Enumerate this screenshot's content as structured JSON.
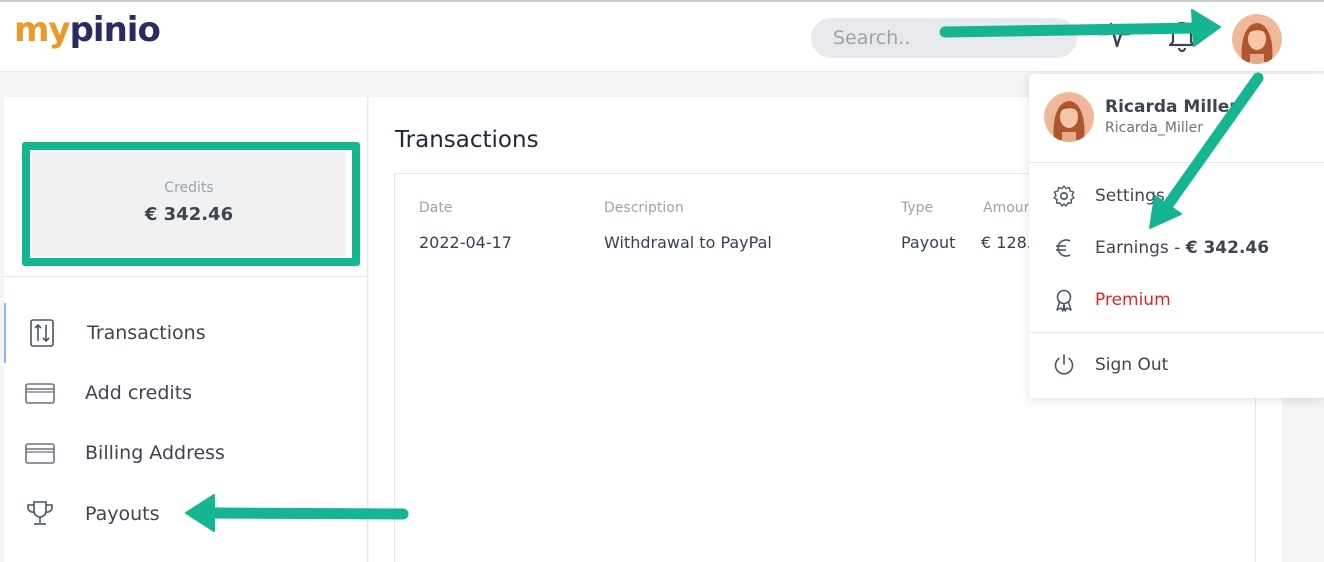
{
  "header": {
    "logo_part1": "my",
    "logo_part2": "pinio",
    "search_placeholder": "Search..",
    "icons": [
      "activity-icon",
      "bell-icon"
    ]
  },
  "sidebar": {
    "credits_label": "Credits",
    "credits_value": "€ 342.46",
    "items": [
      {
        "label": "Transactions",
        "icon": "transactions-icon",
        "active": true
      },
      {
        "label": "Add credits",
        "icon": "credit-card-icon",
        "active": false
      },
      {
        "label": "Billing Address",
        "icon": "credit-card-icon",
        "active": false
      },
      {
        "label": "Payouts",
        "icon": "trophy-icon",
        "active": false
      }
    ]
  },
  "main": {
    "title": "Transactions",
    "table": {
      "columns": [
        "Date",
        "Description",
        "Type",
        "Amour"
      ],
      "rows": [
        [
          "2022-04-17",
          "Withdrawal to PayPal",
          "Payout",
          "€ 128."
        ]
      ]
    }
  },
  "dropdown": {
    "name": "Ricarda Miller",
    "username": "Ricarda_Miller",
    "items": [
      {
        "label": "Settings",
        "icon": "gear-icon"
      },
      {
        "label": "Earnings - ",
        "value": "€ 342.46",
        "icon": "euro-icon"
      },
      {
        "label": "Premium",
        "icon": "award-icon"
      },
      {
        "label": "Sign Out",
        "icon": "power-icon"
      }
    ]
  },
  "colors": {
    "annotation": "#15b592",
    "premium": "#dc2626",
    "logo_orange": "#e89a2a",
    "logo_navy": "#2b2b63"
  }
}
